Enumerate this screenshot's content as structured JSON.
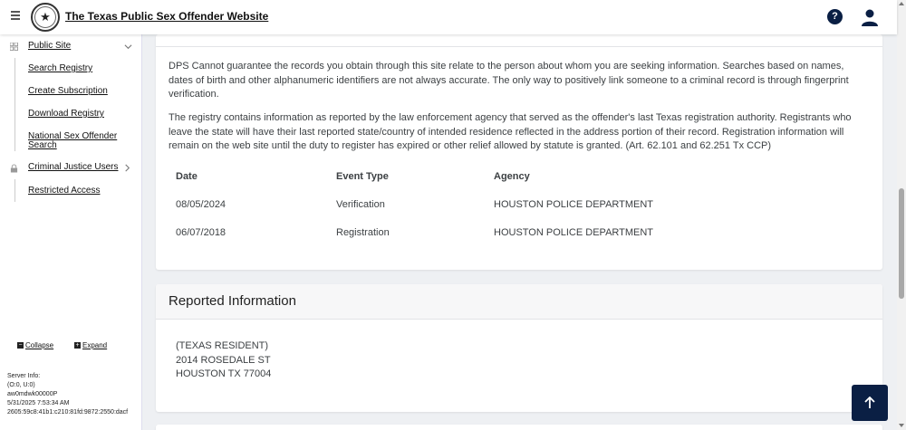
{
  "header": {
    "title": "The Texas Public Sex Offender Website",
    "help_icon_glyph": "?"
  },
  "sidebar": {
    "public_site": {
      "label": "Public Site",
      "items": [
        {
          "label": "Search Registry"
        },
        {
          "label": "Create Subscription"
        },
        {
          "label": "Download Registry"
        },
        {
          "label": "National Sex Offender Search"
        }
      ]
    },
    "cj_users": {
      "label": "Criminal Justice Users",
      "items": [
        {
          "label": "Restricted Access"
        }
      ]
    },
    "collapse_label": "Collapse",
    "expand_label": "Expand",
    "server_info": {
      "label": "Server Info:",
      "line1": "(O:0, U:0)",
      "line2": "aw0mdwk00000P",
      "line3": "5/31/2025 7:53:34 AM",
      "line4": "2605:59c8:41b1:c210:81fd:9872:2550:dacf"
    }
  },
  "disclaimer": {
    "para1": "DPS Cannot guarantee the records you obtain through this site relate to the person about whom you are seeking information. Searches based on names, dates of birth and other alphanumeric identifiers are not always accurate. The only way to positively link someone to a criminal record is through fingerprint verification.",
    "para2": "The registry contains information as reported by the law enforcement agency that served as the offender's last Texas registration authority. Registrants who leave the state will have their last reported state/country of intended residence reflected in the address portion of their record. Registration information will remain on the web site until the duty to register has expired or other relief allowed by statute is granted. (Art. 62.101 and 62.251 Tx CCP)"
  },
  "events_table": {
    "headers": {
      "date": "Date",
      "event_type": "Event Type",
      "agency": "Agency"
    },
    "rows": [
      {
        "date": "08/05/2024",
        "event_type": "Verification",
        "agency": "HOUSTON POLICE DEPARTMENT"
      },
      {
        "date": "06/07/2018",
        "event_type": "Registration",
        "agency": "HOUSTON POLICE DEPARTMENT"
      }
    ]
  },
  "reported_info": {
    "title": "Reported Information",
    "line1": "(TEXAS RESIDENT)",
    "line2": "2014 ROSEDALE ST",
    "line3": "HOUSTON TX 77004"
  },
  "colors": {
    "navy": "#0a1f44",
    "page_bg": "#eef0f3"
  }
}
